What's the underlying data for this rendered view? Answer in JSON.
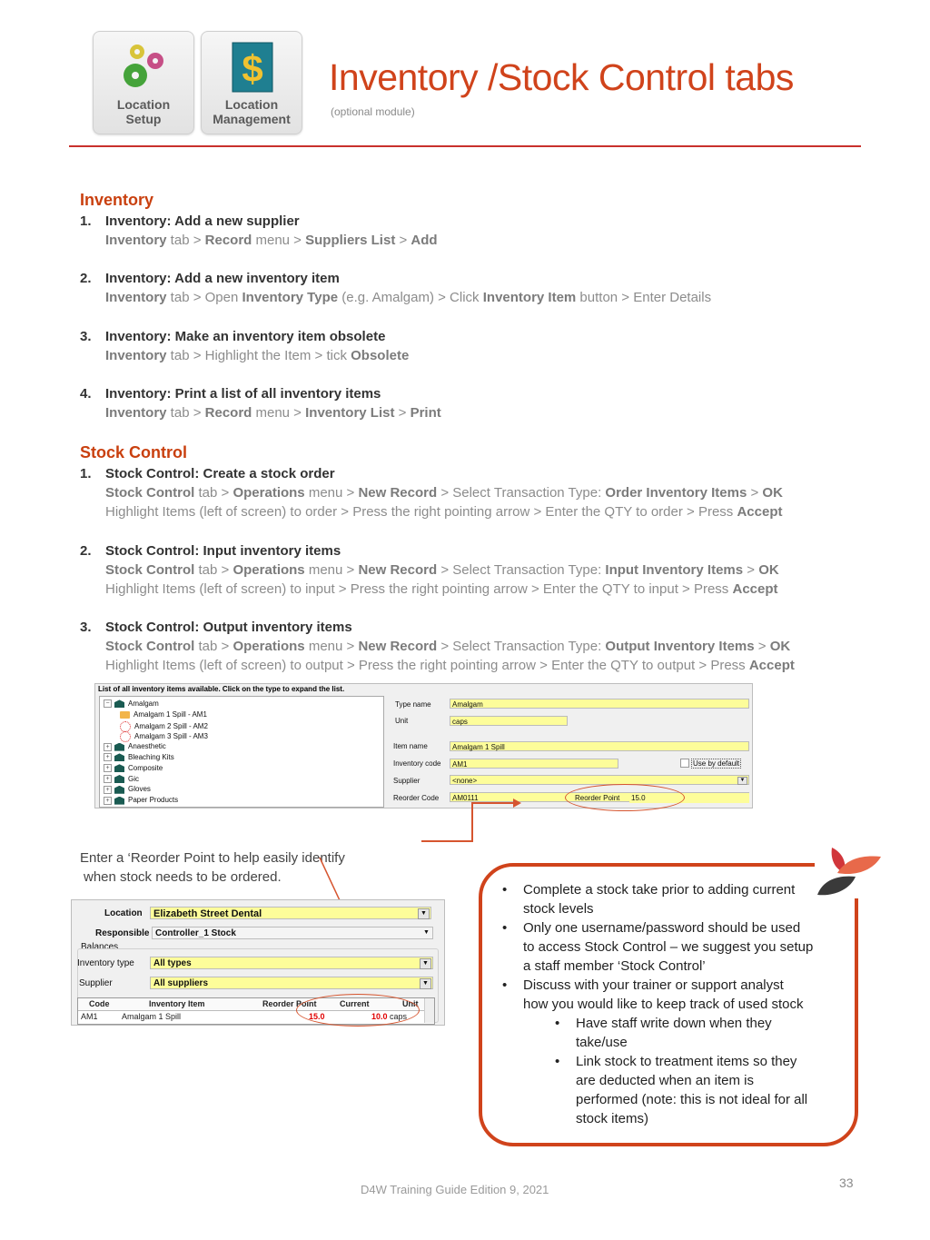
{
  "header": {
    "tiles": [
      {
        "label_line1": "Location",
        "label_line2": "Setup",
        "icon": "gears-icon"
      },
      {
        "label_line1": "Location",
        "label_line2": "Management",
        "icon": "dollar-ledger-icon"
      }
    ],
    "title": "Inventory /Stock Control tabs",
    "subtitle": "(optional module)"
  },
  "inventory": {
    "heading": "Inventory",
    "items": [
      {
        "num": "1.",
        "title": "Inventory: Add a new supplier",
        "path": [
          [
            "Inventory",
            true
          ],
          [
            " tab > ",
            false
          ],
          [
            "Record",
            true
          ],
          [
            " menu > ",
            false
          ],
          [
            "Suppliers List",
            true
          ],
          [
            " > ",
            false
          ],
          [
            "Add",
            true
          ]
        ]
      },
      {
        "num": "2.",
        "title": "Inventory: Add a new inventory item",
        "path": [
          [
            "Inventory",
            true
          ],
          [
            " tab > Open ",
            false
          ],
          [
            "Inventory Type",
            true
          ],
          [
            " (e.g. Amalgam) > Click ",
            false
          ],
          [
            "Inventory Item",
            true
          ],
          [
            " button > Enter Details",
            false
          ]
        ]
      },
      {
        "num": "3.",
        "title": "Inventory: Make an inventory item obsolete",
        "path": [
          [
            "Inventory",
            true
          ],
          [
            " tab > Highlight the Item > tick ",
            false
          ],
          [
            "Obsolete",
            true
          ]
        ]
      },
      {
        "num": "4.",
        "title": "Inventory: Print a list of all inventory items",
        "path": [
          [
            "Inventory",
            true
          ],
          [
            " tab > ",
            false
          ],
          [
            "Record",
            true
          ],
          [
            " menu > ",
            false
          ],
          [
            "Inventory List",
            true
          ],
          [
            " > ",
            false
          ],
          [
            "Print",
            true
          ]
        ]
      }
    ]
  },
  "stock_control": {
    "heading": "Stock Control",
    "items": [
      {
        "num": "1.",
        "title": "Stock Control: Create a stock order",
        "path": [
          [
            "Stock Control",
            true
          ],
          [
            " tab > ",
            false
          ],
          [
            "Operations",
            true
          ],
          [
            " menu > ",
            false
          ],
          [
            "New Record",
            true
          ],
          [
            " > Select Transaction Type: ",
            false
          ],
          [
            "Order Inventory Items",
            true
          ],
          [
            " > ",
            false
          ],
          [
            "OK",
            true
          ]
        ],
        "path2": [
          [
            "Highlight Items (left of screen) to order > Press the right pointing arrow > Enter the QTY to order > Press ",
            false
          ],
          [
            "Accept",
            true
          ]
        ]
      },
      {
        "num": "2.",
        "title": "Stock Control: Input inventory items",
        "path": [
          [
            "Stock Control",
            true
          ],
          [
            " tab > ",
            false
          ],
          [
            "Operations",
            true
          ],
          [
            " menu > ",
            false
          ],
          [
            "New Record",
            true
          ],
          [
            " > Select Transaction Type: ",
            false
          ],
          [
            "Input Inventory Items",
            true
          ],
          [
            " > ",
            false
          ],
          [
            "OK",
            true
          ]
        ],
        "path2": [
          [
            "Highlight Items (left of screen) to input > Press the right pointing arrow > Enter the QTY to input > Press ",
            false
          ],
          [
            "Accept",
            true
          ]
        ]
      },
      {
        "num": "3.",
        "title": "Stock Control: Output inventory items",
        "path": [
          [
            "Stock Control",
            true
          ],
          [
            " tab > ",
            false
          ],
          [
            "Operations",
            true
          ],
          [
            " menu > ",
            false
          ],
          [
            "New Record",
            true
          ],
          [
            " > Select Transaction Type: ",
            false
          ],
          [
            "Output Inventory Items",
            true
          ],
          [
            " > ",
            false
          ],
          [
            "OK",
            true
          ]
        ],
        "path2": [
          [
            "Highlight Items (left of screen) to output > Press the right pointing arrow > Enter the QTY to output > Press ",
            false
          ],
          [
            "Accept",
            true
          ]
        ]
      }
    ]
  },
  "inventory_screen": {
    "caption": "List of all inventory items available. Click on the type to expand the list.",
    "tree": [
      {
        "label": "Amalgam",
        "level": 0,
        "expanded": true
      },
      {
        "label": "Amalgam 1 Spill - AM1",
        "level": 1,
        "icon": "folder-open"
      },
      {
        "label": "Amalgam 2 Spill - AM2",
        "level": 1,
        "icon": "item"
      },
      {
        "label": "Amalgam 3 Spill - AM3",
        "level": 1,
        "icon": "item"
      },
      {
        "label": "Anaesthetic",
        "level": 0,
        "expanded": false
      },
      {
        "label": "Bleaching Kits",
        "level": 0,
        "expanded": false
      },
      {
        "label": "Composite",
        "level": 0,
        "expanded": false
      },
      {
        "label": "Gic",
        "level": 0,
        "expanded": false
      },
      {
        "label": "Gloves",
        "level": 0,
        "expanded": false
      },
      {
        "label": "Paper Products",
        "level": 0,
        "expanded": false
      }
    ],
    "form": {
      "type_name_label": "Type name",
      "type_name": "Amalgam",
      "unit_label": "Unit",
      "unit": "caps",
      "item_name_label": "Item name",
      "item_name": "Amalgam 1 Spill",
      "inventory_code_label": "Inventory code",
      "inventory_code": "AM1",
      "use_by_default_label": "Use by default",
      "use_by_default": false,
      "supplier_label": "Supplier",
      "supplier": "<none>",
      "reorder_code_label": "Reorder Code",
      "reorder_code": "AM0111",
      "reorder_point_label": "Reorder Point",
      "reorder_point": "15.0"
    }
  },
  "note": {
    "line1": "Enter a ‘Reorder Point to help easily identify",
    "line2": "when stock needs to be ordered."
  },
  "stock_screen": {
    "location_label": "Location",
    "location": "Elizabeth Street Dental",
    "responsible_label": "Responsible",
    "responsible": "Controller_1 Stock",
    "balances_label": "Balances",
    "inventory_type_label": "Inventory type",
    "inventory_type": "All types",
    "supplier_label": "Supplier",
    "supplier": "All suppliers",
    "columns": [
      "Code",
      "Inventory Item",
      "Reorder Point",
      "Current",
      "Unit"
    ],
    "rows": [
      {
        "code": "AM1",
        "item": "Amalgam 1 Spill",
        "reorder_point": "15.0",
        "current": "10.0",
        "unit": "caps"
      }
    ]
  },
  "callout": {
    "bullets": [
      [
        "Complete a stock take prior to adding current",
        "stock levels"
      ],
      [
        "Only one username/password should be used",
        "to access Stock Control – we suggest you setup",
        "a staff member ‘Stock Control’"
      ],
      [
        "Discuss with your trainer or support analyst",
        "how you would like to keep track of used stock"
      ]
    ],
    "sub_bullets": [
      [
        "Have staff write down when they",
        "take/use"
      ],
      [
        "Link stock to treatment items so they",
        "are deducted when an item is",
        "performed (note: this is not ideal for all",
        "stock items)"
      ]
    ]
  },
  "footer": {
    "text": "D4W Training Guide Edition 9, 2021",
    "page_number": "33"
  }
}
